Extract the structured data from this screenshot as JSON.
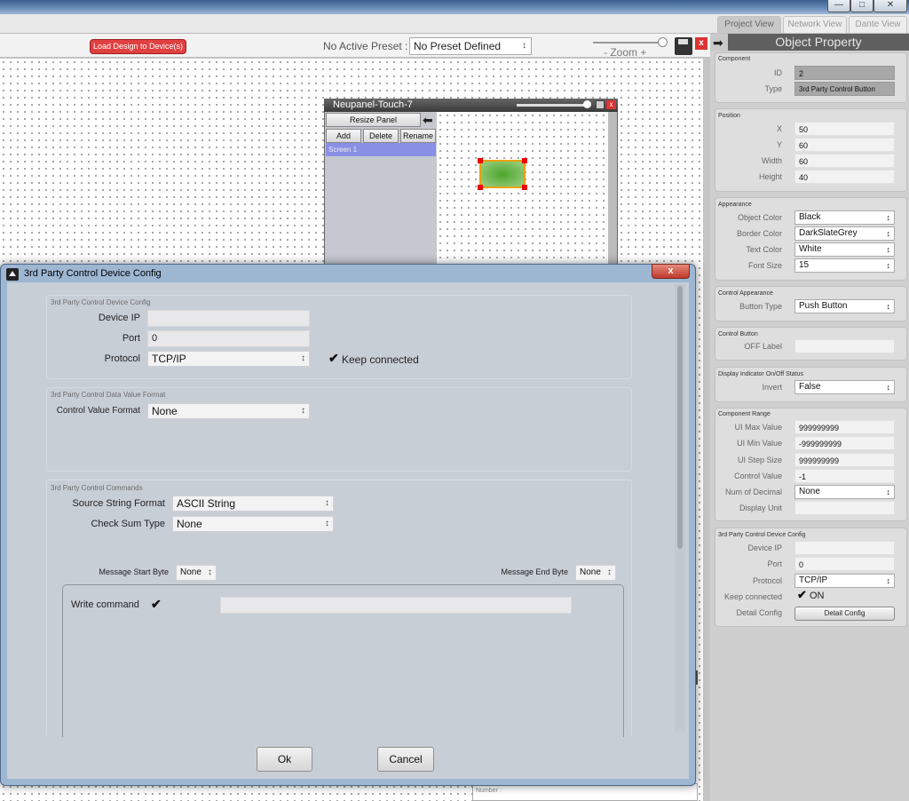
{
  "window": {
    "minimize": "—",
    "restore": "□",
    "close": "✕"
  },
  "view_tabs": [
    "Project View",
    "Network View",
    "Dante View"
  ],
  "toolbar": {
    "load_button": "Load Design to Device(s)",
    "preset_label": "No Active Preset :",
    "preset_value": "No Preset Defined",
    "zoom_label": "-  Zoom  +"
  },
  "neupanel": {
    "title": "Neupanel-Touch-7",
    "resize": "Resize Panel",
    "add": "Add",
    "delete": "Delete",
    "rename": "Rename",
    "screen": "Screen 1",
    "close": "x"
  },
  "object_property": {
    "title": "Object Property",
    "component": {
      "title": "Component",
      "id_label": "ID",
      "id": "2",
      "type_label": "Type",
      "type": "3rd Party Control Button"
    },
    "position": {
      "title": "Position",
      "x_label": "X",
      "x": "50",
      "y_label": "Y",
      "y": "60",
      "width_label": "Width",
      "width": "60",
      "height_label": "Height",
      "height": "40"
    },
    "appearance": {
      "title": "Appearance",
      "object_color_label": "Object Color",
      "object_color": "Black",
      "border_color_label": "Border Color",
      "border_color": "DarkSlateGrey",
      "text_color_label": "Text Color",
      "text_color": "White",
      "font_size_label": "Font Size",
      "font_size": "15"
    },
    "control_appearance": {
      "title": "Control Appearance",
      "button_type_label": "Button Type",
      "button_type": "Push Button"
    },
    "control_button": {
      "title": "Control Button",
      "off_label_label": "OFF Label",
      "off_label": ""
    },
    "display_indicator": {
      "title": "Display Indicator On/Off Status",
      "invert_label": "Invert",
      "invert": "False"
    },
    "component_range": {
      "title": "Component Range",
      "ui_max_label": "UI Max Value",
      "ui_max": "999999999",
      "ui_min_label": "UI Min Value",
      "ui_min": "-999999999",
      "ui_step_label": "UI Step Size",
      "ui_step": "999999999",
      "control_value_label": "Control Value",
      "control_value": "-1",
      "num_decimal_label": "Num of Decimal",
      "num_decimal": "None",
      "display_unit_label": "Display Unit",
      "display_unit": ""
    },
    "device_config": {
      "title": "3rd Party Control Device Config",
      "device_ip_label": "Device IP",
      "device_ip": "",
      "port_label": "Port",
      "port": "0",
      "protocol_label": "Protocol",
      "protocol": "TCP/IP",
      "keep_connected_label": "Keep connected",
      "keep_connected": "ON",
      "detail_config_label": "Detail Config",
      "detail_config_button": "Detail Config"
    }
  },
  "number_field": "Number :",
  "dialog": {
    "title": "3rd Party Control Device Config",
    "close": "x",
    "device_config": {
      "legend": "3rd Party Control Device Config",
      "device_ip_label": "Device IP",
      "device_ip": "",
      "port_label": "Port",
      "port": "0",
      "protocol_label": "Protocol",
      "protocol": "TCP/IP",
      "keep_connected_label": "Keep connected"
    },
    "data_value_format": {
      "legend": "3rd Party Control Data Value Format",
      "control_value_format_label": "Control Value Format",
      "control_value_format": "None"
    },
    "commands": {
      "legend": "3rd Party Control Commands",
      "source_format_label": "Source String Format",
      "source_format": "ASCII String",
      "checksum_label": "Check Sum Type",
      "checksum": "None",
      "start_byte_label": "Message Start Byte",
      "start_byte": "None",
      "end_byte_label": "Message End Byte",
      "end_byte": "None",
      "write_command_label": "Write command",
      "write_command": ""
    },
    "ok": "Ok",
    "cancel": "Cancel"
  },
  "icons": {
    "check": "✔",
    "arrow": "⬅",
    "forward": "➡"
  }
}
